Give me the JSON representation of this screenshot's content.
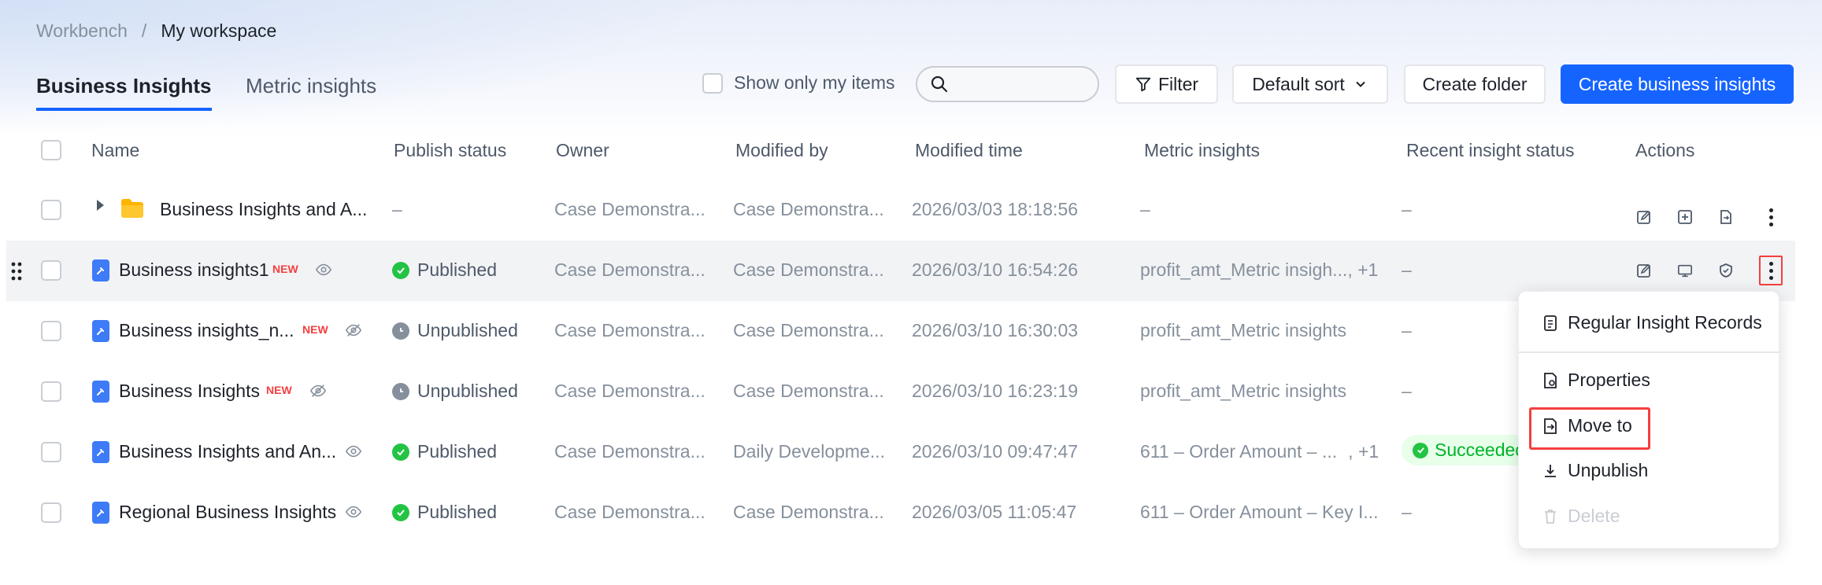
{
  "breadcrumb": {
    "root": "Workbench",
    "separator": "/",
    "current": "My workspace"
  },
  "tabs": [
    {
      "label": "Business Insights",
      "active": true
    },
    {
      "label": "Metric insights",
      "active": false
    }
  ],
  "toolbar": {
    "show_mine": "Show only my items",
    "search_placeholder": "",
    "filter": "Filter",
    "sort": "Default sort",
    "create_folder": "Create folder",
    "create_insight": "Create business insights"
  },
  "columns": {
    "name": "Name",
    "publish_status": "Publish status",
    "owner": "Owner",
    "modified_by": "Modified by",
    "modified_time": "Modified time",
    "metric_insights": "Metric insights",
    "recent_status": "Recent insight status",
    "actions": "Actions"
  },
  "rows": [
    {
      "name": "Business Insights and A...",
      "is_new": false,
      "new_label": "",
      "status": "–",
      "owner": "Case Demonstra...",
      "modified_by": "Case Demonstra...",
      "time": "2026/03/03 18:18:56",
      "metric": "–",
      "metric_extra": "",
      "recent": "–"
    },
    {
      "name": "Business insights1",
      "is_new": true,
      "new_label": "NEW",
      "status": "Published",
      "owner": "Case Demonstra...",
      "modified_by": "Case Demonstra...",
      "time": "2026/03/10 16:54:26",
      "metric": "profit_amt_Metric insigh...",
      "metric_extra": ", +1",
      "recent": "–"
    },
    {
      "name": "Business insights_n...",
      "is_new": true,
      "new_label": "NEW",
      "status": "Unpublished",
      "owner": "Case Demonstra...",
      "modified_by": "Case Demonstra...",
      "time": "2026/03/10 16:30:03",
      "metric": "profit_amt_Metric insights",
      "metric_extra": "",
      "recent": "–"
    },
    {
      "name": "Business Insights",
      "is_new": true,
      "new_label": "NEW",
      "status": "Unpublished",
      "owner": "Case Demonstra...",
      "modified_by": "Case Demonstra...",
      "time": "2026/03/10 16:23:19",
      "metric": "profit_amt_Metric insights",
      "metric_extra": "",
      "recent": "–"
    },
    {
      "name": "Business Insights and An...",
      "is_new": false,
      "new_label": "",
      "status": "Published",
      "owner": "Case Demonstra...",
      "modified_by": "Daily Developme...",
      "time": "2026/03/10 09:47:47",
      "metric": "611 – Order Amount – ...",
      "metric_extra": ", +1",
      "recent": "Succeeded"
    },
    {
      "name": "Regional Business Insights",
      "is_new": false,
      "new_label": "",
      "status": "Published",
      "owner": "Case Demonstra...",
      "modified_by": "Case Demonstra...",
      "time": "2026/03/05 11:05:47",
      "metric": "611 – Order Amount – Key I...",
      "metric_extra": "",
      "recent": "–"
    }
  ],
  "menu": {
    "records": "Regular Insight Records",
    "properties": "Properties",
    "move_to": "Move to",
    "unpublish": "Unpublish",
    "delete": "Delete"
  },
  "colors": {
    "accent": "#1664ff",
    "published": "#23c343",
    "new": "#f53f3f",
    "highlight": "#f53f3f"
  }
}
